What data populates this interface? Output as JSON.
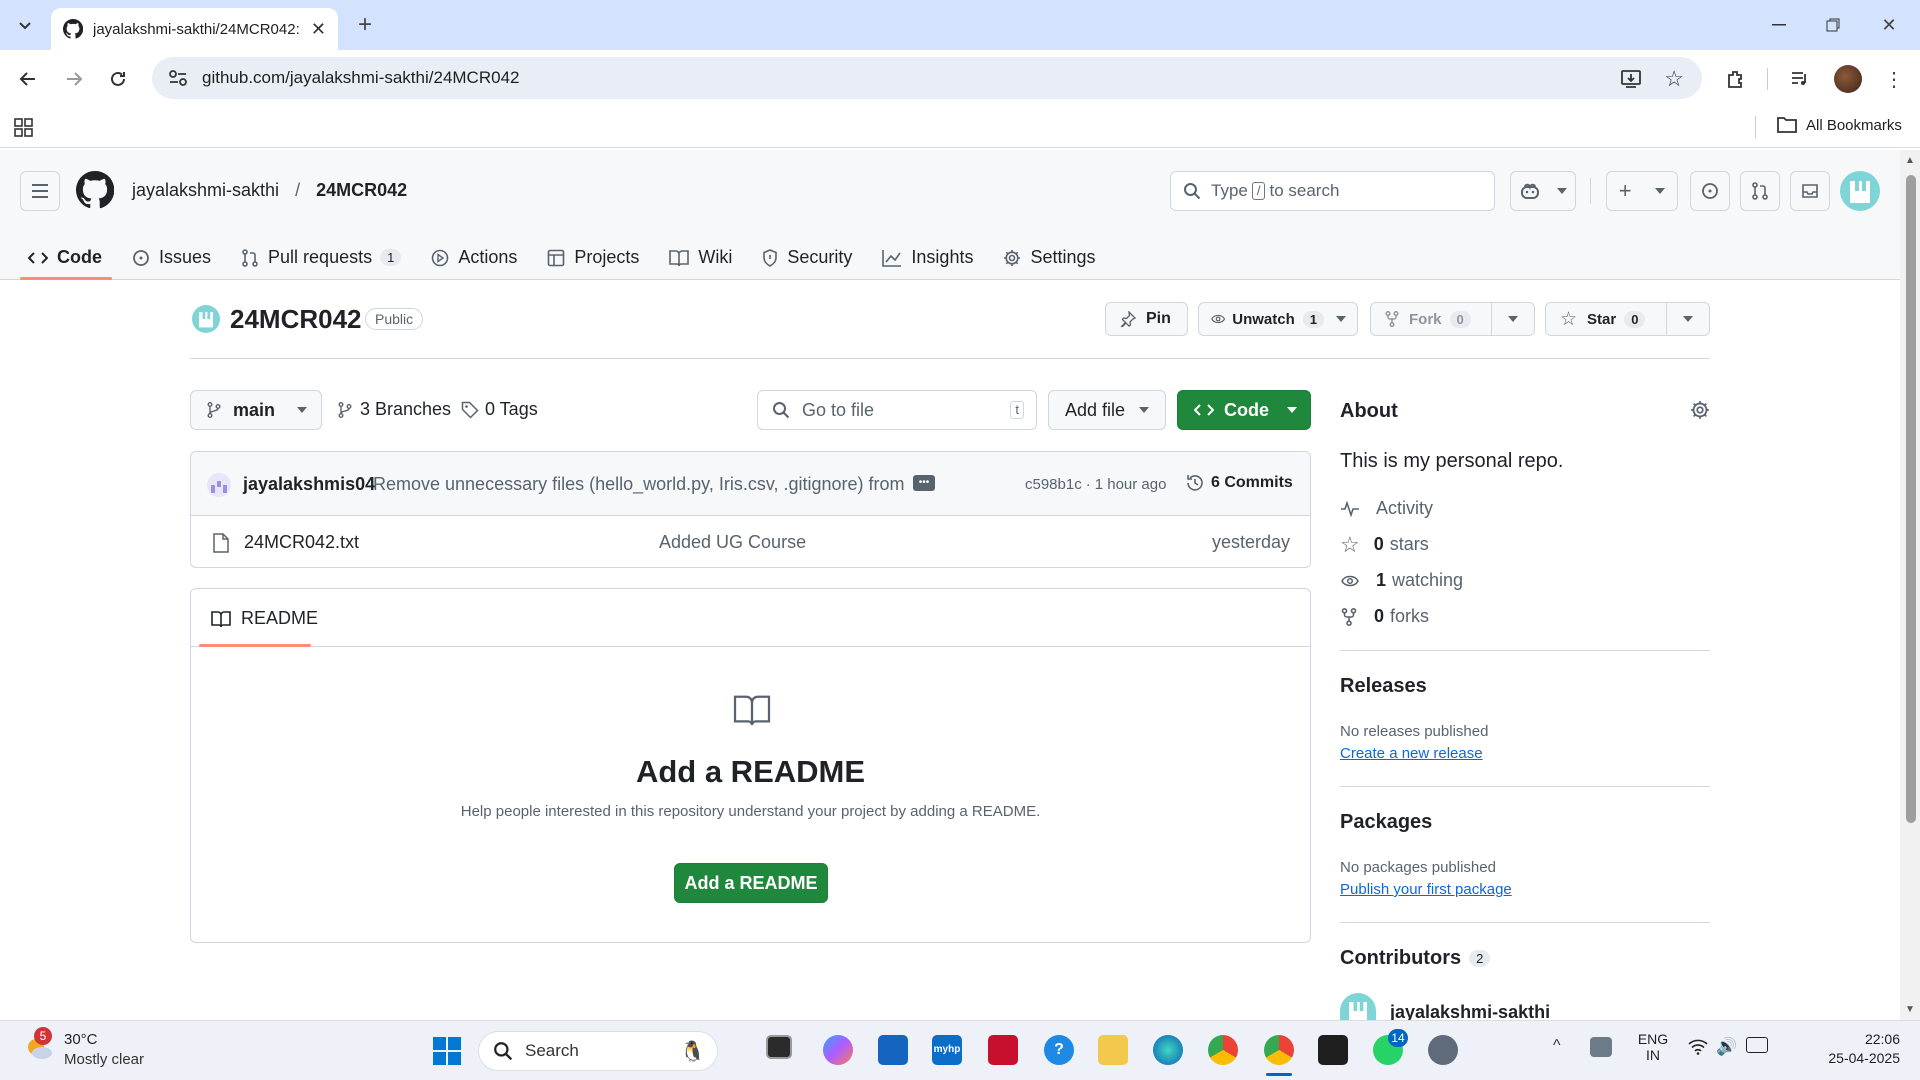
{
  "browser": {
    "tab_title": "jayalakshmi-sakthi/24MCR042: ",
    "url": "github.com/jayalakshmi-sakthi/24MCR042",
    "all_bookmarks": "All Bookmarks"
  },
  "header": {
    "owner": "jayalakshmi-sakthi",
    "slash": "/",
    "repo": "24MCR042",
    "search_prefix": "Type",
    "search_key": "/",
    "search_suffix": "to search"
  },
  "nav": {
    "tabs": [
      {
        "label": "Code",
        "icon": "code-icon"
      },
      {
        "label": "Issues",
        "icon": "issue-icon"
      },
      {
        "label": "Pull requests",
        "icon": "pull-request-icon",
        "count": "1"
      },
      {
        "label": "Actions",
        "icon": "play-icon"
      },
      {
        "label": "Projects",
        "icon": "table-icon"
      },
      {
        "label": "Wiki",
        "icon": "book-icon"
      },
      {
        "label": "Security",
        "icon": "shield-icon"
      },
      {
        "label": "Insights",
        "icon": "graph-icon"
      },
      {
        "label": "Settings",
        "icon": "gear-icon"
      }
    ]
  },
  "repo": {
    "name": "24MCR042",
    "visibility": "Public",
    "pin": "Pin",
    "unwatch": "Unwatch",
    "watch_count": "1",
    "fork": "Fork",
    "fork_count": "0",
    "star": "Star",
    "star_count": "0"
  },
  "filebar": {
    "branch": "main",
    "branches": "3 Branches",
    "tags": "0 Tags",
    "go_to_file": "Go to file",
    "go_to_file_key": "t",
    "add_file": "Add file",
    "code": "Code"
  },
  "commit": {
    "author": "jayalakshmis04",
    "message": "Remove unnecessary files (hello_world.py, Iris.csv, .gitignore) from ...",
    "hash": "c598b1c",
    "dot": "·",
    "time": "1 hour ago",
    "commits": "6 Commits"
  },
  "files": [
    {
      "name": "24MCR042.txt",
      "message": "Added UG Course",
      "time": "yesterday"
    }
  ],
  "readme": {
    "tab": "README",
    "title": "Add a README",
    "help": "Help people interested in this repository understand your project by adding a README.",
    "button": "Add a README"
  },
  "about": {
    "title": "About",
    "description": "This is my personal repo.",
    "activity": "Activity",
    "stars_n": "0",
    "stars": "stars",
    "watching_n": "1",
    "watching": "watching",
    "forks_n": "0",
    "forks": "forks"
  },
  "releases": {
    "title": "Releases",
    "none": "No releases published",
    "link": "Create a new release"
  },
  "packages": {
    "title": "Packages",
    "none": "No packages published",
    "link": "Publish your first package"
  },
  "contributors": {
    "title": "Contributors",
    "count": "2",
    "first": "jayalakshmi-sakthi"
  },
  "taskbar": {
    "weather_temp": "30°C",
    "weather_desc": "Mostly clear",
    "weather_badge": "5",
    "search": "Search",
    "whatsapp_badge": "14",
    "lang1": "ENG",
    "lang2": "IN",
    "time": "22:06",
    "date": "25-04-2025"
  },
  "colors": {
    "accent_green": "#1f883d",
    "link_blue": "#0969da",
    "tab_underline": "#fd8c73"
  }
}
